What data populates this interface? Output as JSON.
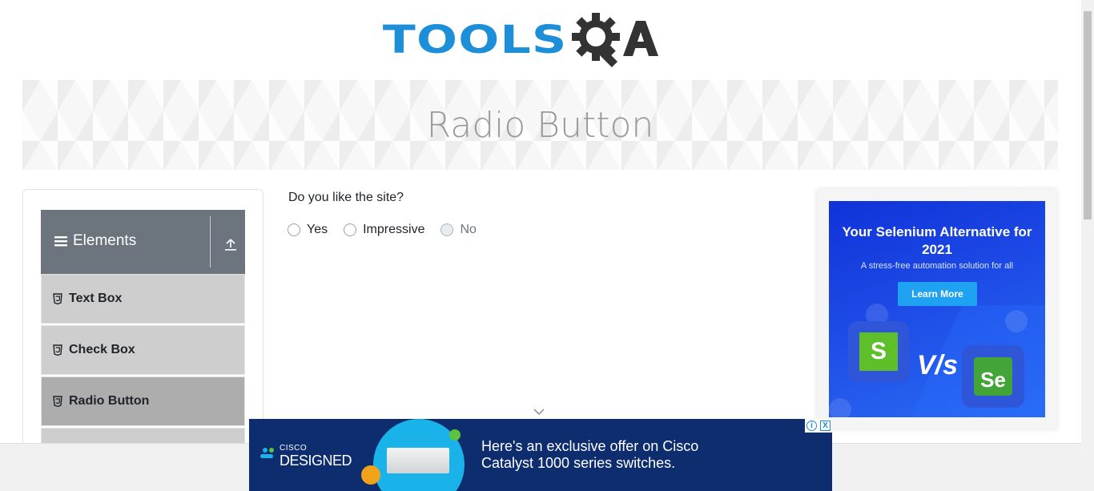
{
  "brand": {
    "logo_text_tools": "TOOLS",
    "logo_text_qa": "QA",
    "logo_color": "#1d8ed8",
    "logo_dark": "#333333"
  },
  "banner": {
    "title": "Radio Button"
  },
  "sidebar": {
    "group_label": "Elements",
    "group_icon": "hamburger-icon",
    "toggle_icon": "collapse-up-icon",
    "items": [
      {
        "label": "Text Box",
        "icon": "html5-icon"
      },
      {
        "label": "Check Box",
        "icon": "html5-icon"
      },
      {
        "label": "Radio Button",
        "icon": "html5-icon",
        "active": true
      }
    ]
  },
  "main": {
    "question": "Do you like the site?",
    "options": [
      {
        "label": "Yes",
        "disabled": false
      },
      {
        "label": "Impressive",
        "disabled": false
      },
      {
        "label": "No",
        "disabled": true
      }
    ]
  },
  "right_ad": {
    "title": "Your Selenium Alternative for 2021",
    "subtitle": "A stress-free automation solution for all",
    "button": "Learn More",
    "vs_text": "V/s",
    "left_logo_letter": "S",
    "right_logo_letters": "Se"
  },
  "bottom_ad": {
    "brand_small": "CISCO",
    "brand_big": "DESIGNED",
    "text": "Here's an exclusive offer on Cisco Catalyst 1000 series switches.",
    "adchoices_info": "i",
    "adchoices_close": "X"
  }
}
